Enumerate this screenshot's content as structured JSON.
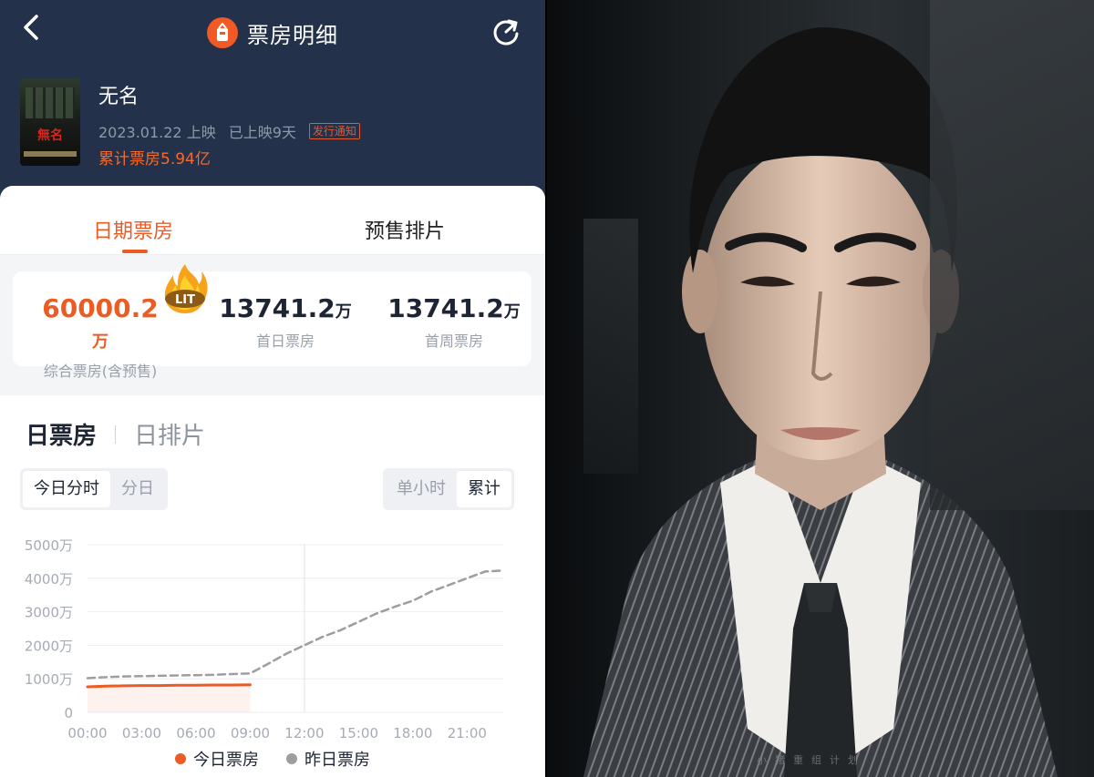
{
  "nav": {
    "title": "票房明细"
  },
  "movie": {
    "name": "无名",
    "release_date": "2023.01.22 上映",
    "days_showing": "已上映9天",
    "tag": "发行通知",
    "total": "累计票房5.94亿"
  },
  "tabs": {
    "active": "日期票房",
    "inactive": "预售排片"
  },
  "stats": [
    {
      "value": "60000.2",
      "unit": "万",
      "label": "综合票房(含预售)"
    },
    {
      "value": "13741.2",
      "unit": "万",
      "label": "首日票房"
    },
    {
      "value": "13741.2",
      "unit": "万",
      "label": "首周票房"
    }
  ],
  "fire_badge": "LIT",
  "section_tabs": {
    "active": "日票房",
    "inactive": "日排片"
  },
  "seg_left": [
    "今日分时",
    "分日"
  ],
  "seg_right": [
    "单小时",
    "累计"
  ],
  "chart_data": {
    "type": "line",
    "x": [
      "00:00",
      "03:00",
      "06:00",
      "09:00",
      "12:00",
      "15:00",
      "18:00",
      "21:00"
    ],
    "yticks": [
      "5000万",
      "4000万",
      "3000万",
      "2000万",
      "1000万",
      "0"
    ],
    "ylim": [
      0,
      5000
    ],
    "series": [
      {
        "name": "今日票房",
        "color": "#ec5b24",
        "style": "solid",
        "points": [
          [
            0,
            760
          ],
          [
            1,
            780
          ],
          [
            2,
            790
          ],
          [
            3,
            800
          ],
          [
            4,
            800
          ],
          [
            5,
            810
          ],
          [
            6,
            810
          ],
          [
            7,
            815
          ],
          [
            8,
            815
          ],
          [
            9,
            820
          ]
        ]
      },
      {
        "name": "昨日票房",
        "color": "#9e9e9e",
        "style": "dashed",
        "points": [
          [
            0,
            1020
          ],
          [
            1,
            1050
          ],
          [
            2,
            1070
          ],
          [
            3,
            1080
          ],
          [
            4,
            1090
          ],
          [
            5,
            1100
          ],
          [
            6,
            1110
          ],
          [
            7,
            1120
          ],
          [
            8,
            1140
          ],
          [
            9,
            1160
          ],
          [
            10,
            1450
          ],
          [
            11,
            1750
          ],
          [
            12,
            2000
          ],
          [
            13,
            2250
          ],
          [
            14,
            2450
          ],
          [
            15,
            2700
          ],
          [
            16,
            2950
          ],
          [
            17,
            3150
          ],
          [
            18,
            3330
          ],
          [
            19,
            3600
          ],
          [
            20,
            3800
          ],
          [
            21,
            4000
          ],
          [
            22,
            4200
          ],
          [
            23,
            4230
          ]
        ]
      }
    ],
    "current_hour": 12
  },
  "photo": {
    "watermark": "小猪重组计划"
  }
}
